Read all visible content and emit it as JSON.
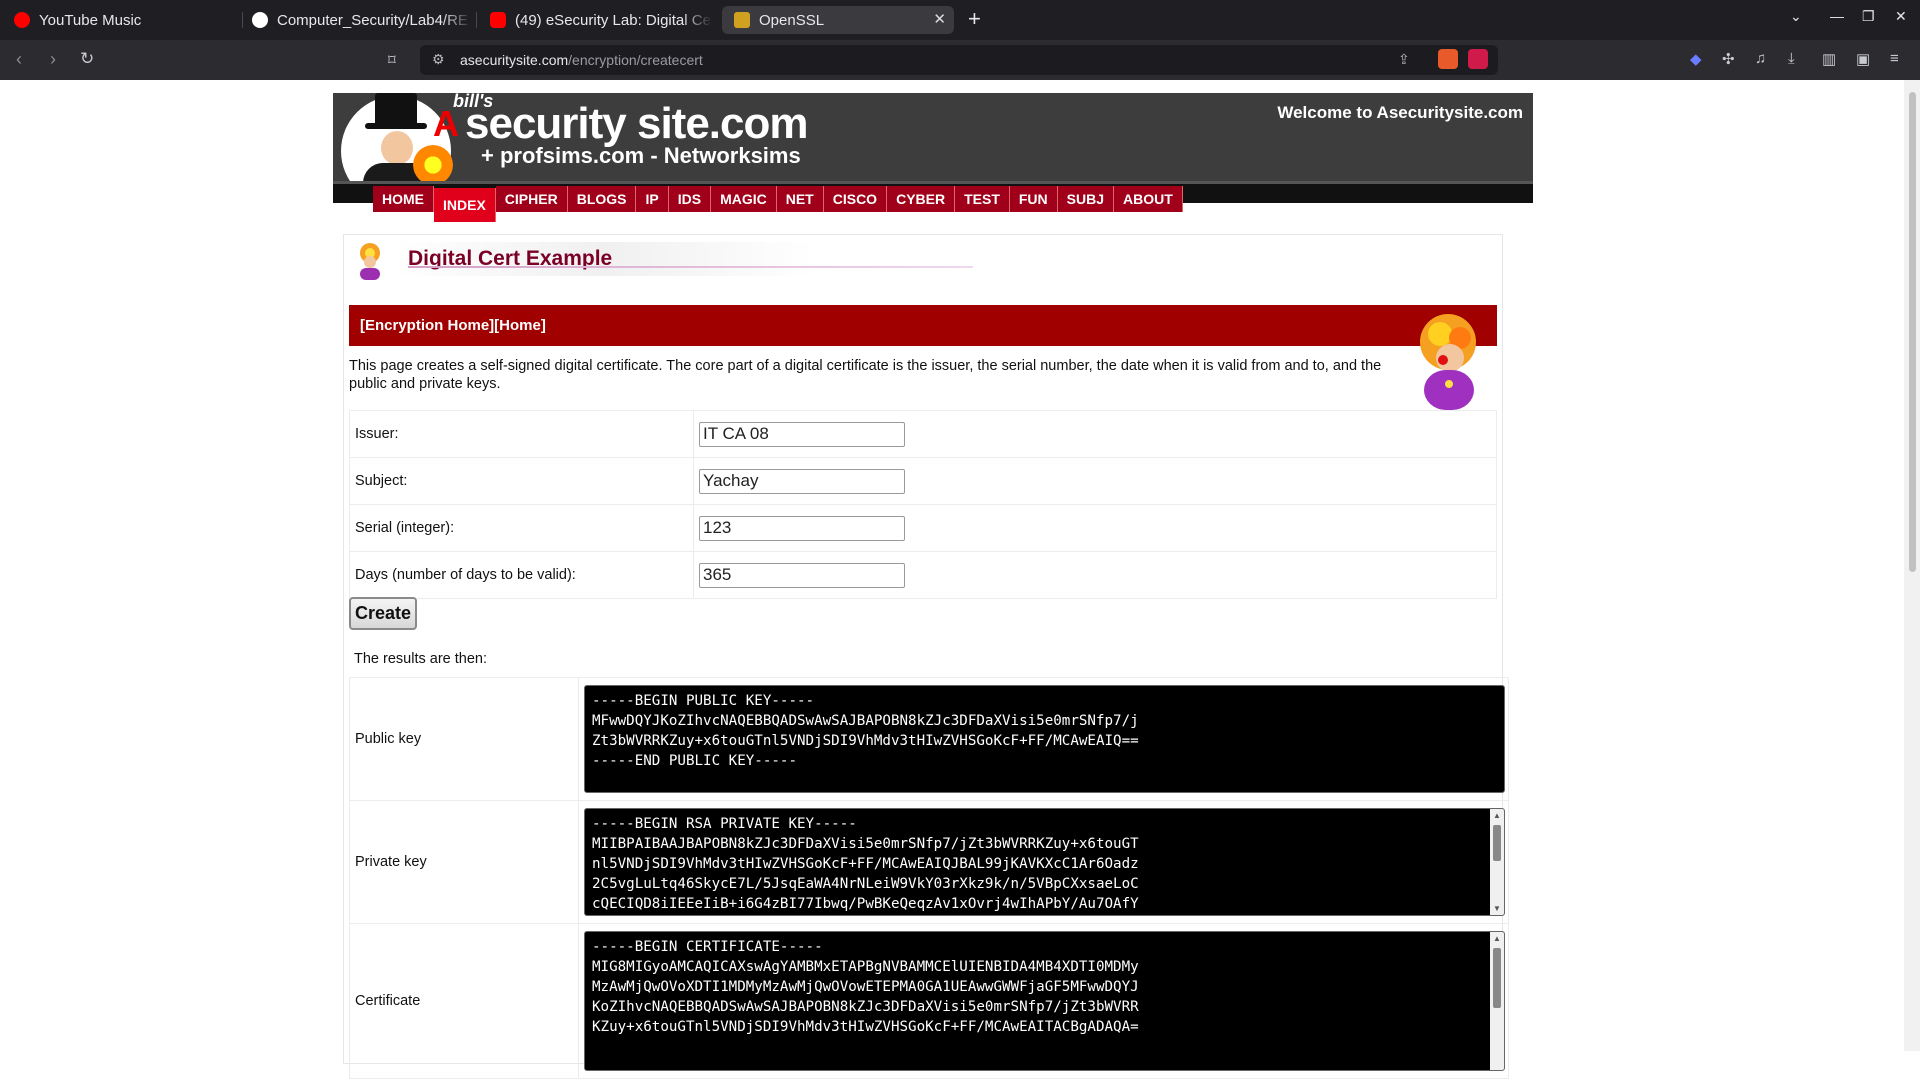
{
  "browser": {
    "tabs": [
      {
        "title": "YouTube Music",
        "color": "#ff0000"
      },
      {
        "title": "Computer_Security/Lab4/RE",
        "color": "#ffffff"
      },
      {
        "title": "(49) eSecurity Lab: Digital Ce",
        "color": "#ff0000"
      },
      {
        "title": "OpenSSL",
        "color": "#d0a020"
      }
    ],
    "url_host": "asecuritysite.com",
    "url_path": "/encryption/createcert",
    "brave_badge": "2"
  },
  "header": {
    "bills": "bill's",
    "site_title": "security site.com",
    "site_letter": "A",
    "subtitle": "+ profsims.com - Networksims",
    "welcome": "Welcome to Asecuritysite.com"
  },
  "menu": [
    "HOME",
    "INDEX",
    "CIPHER",
    "BLOGS",
    "IP",
    "IDS",
    "MAGIC",
    "NET",
    "CISCO",
    "CYBER",
    "TEST",
    "FUN",
    "SUBJ",
    "ABOUT"
  ],
  "menu_active": "INDEX",
  "page": {
    "title": "Digital Cert Example",
    "breadcrumb": "[Encryption Home][Home]",
    "intro": "This page creates a self-signed digital certificate. The core part of a digital certificate is the issuer, the serial number, the date when it is valid from and to, and the public and private keys."
  },
  "form": {
    "fields": [
      {
        "label": "Issuer:",
        "value": "IT CA 08"
      },
      {
        "label": "Subject:",
        "value": "Yachay"
      },
      {
        "label": "Serial (integer):",
        "value": "123"
      },
      {
        "label": "Days (number of days to be valid):",
        "value": "365"
      }
    ],
    "create_label": "Create"
  },
  "results": {
    "label": "The results are then:",
    "public_key_label": "Public key",
    "public_key": "-----BEGIN PUBLIC KEY-----\nMFwwDQYJKoZIhvcNAQEBBQADSwAwSAJBAPOBN8kZJc3DFDaXVisi5e0mrSNfp7/j\nZt3bWVRRKZuy+x6touGTnl5VNDjSDI9VhMdv3tHIwZVHSGoKcF+FF/MCAwEAIQ==\n-----END PUBLIC KEY-----",
    "private_key_label": "Private key",
    "private_key": "-----BEGIN RSA PRIVATE KEY-----\nMIIBPAIBAAJBAPOBN8kZJc3DFDaXVisi5e0mrSNfp7/jZt3bWVRRKZuy+x6touGT\nnl5VNDjSDI9VhMdv3tHIwZVHSGoKcF+FF/MCAwEAIQJBAL99jKAVKXcC1Ar6Oadz\n2C5vgLuLtq46SkycE7L/5JsqEaWA4NrNLeiW9VkY03rXkz9k/n/5VBpCXxsaeLoC\ncQECIQD8iIEEeIiB+i6G4zBI77Ibwq/PwBKeQeqzAv1xOvrj4wIhAPbY/Au7OAfY",
    "certificate_label": "Certificate",
    "certificate": "-----BEGIN CERTIFICATE-----\nMIG8MIGyoAMCAQICAXswAgYAMBMxETAPBgNVBAMMCElUIENBIDA4MB4XDTI0MDMy\nMzAwMjQwOVoXDTI1MDMyMzAwMjQwOVowETEPMA0GA1UEAwwGWWFjaGF5MFwwDQYJ\nKoZIhvcNAQEBBQADSwAwSAJBAPOBN8kZJc3DFDaXVisi5e0mrSNfp7/jZt3bWVRR\nKZuy+x6touGTnl5VNDjSDI9VhMdv3tHIwZVHSGoKcF+FF/MCAwEAITACBgADAQA="
  }
}
